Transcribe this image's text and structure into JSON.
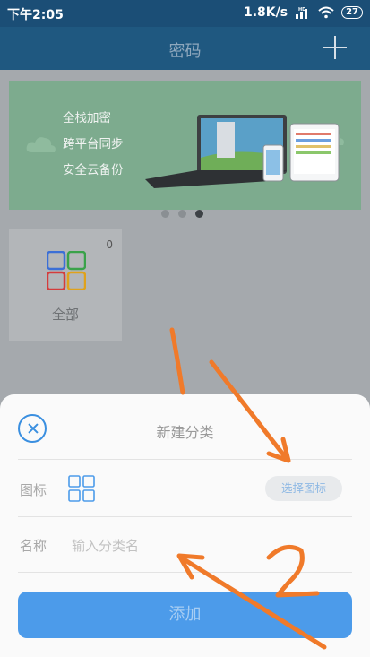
{
  "status_bar": {
    "time": "下午2:05",
    "network_speed": "1.8K/s",
    "signal_label": "HD",
    "battery_level": "27"
  },
  "app_bar": {
    "title": "密码",
    "add_icon": "plus-icon"
  },
  "banner": {
    "lines": [
      "全栈加密",
      "跨平台同步",
      "安全云备份"
    ],
    "pager_active_index": 2,
    "pager_count": 3
  },
  "category_card": {
    "count": "0",
    "label": "全部",
    "icon_colors": [
      "#3b6fd6",
      "#3aa24a",
      "#d43c3c",
      "#e0a21b"
    ]
  },
  "dialog": {
    "title": "新建分类",
    "icon_row_label": "图标",
    "choose_icon_label": "选择图标",
    "name_row_label": "名称",
    "name_placeholder": "输入分类名",
    "name_value": "",
    "submit_label": "添加"
  },
  "annotations": {
    "labels": [
      "1",
      "2"
    ],
    "color": "#f07a2a"
  },
  "colors": {
    "primary": "#1f5880",
    "accent": "#3a8fe0",
    "button": "#4c9bea"
  }
}
